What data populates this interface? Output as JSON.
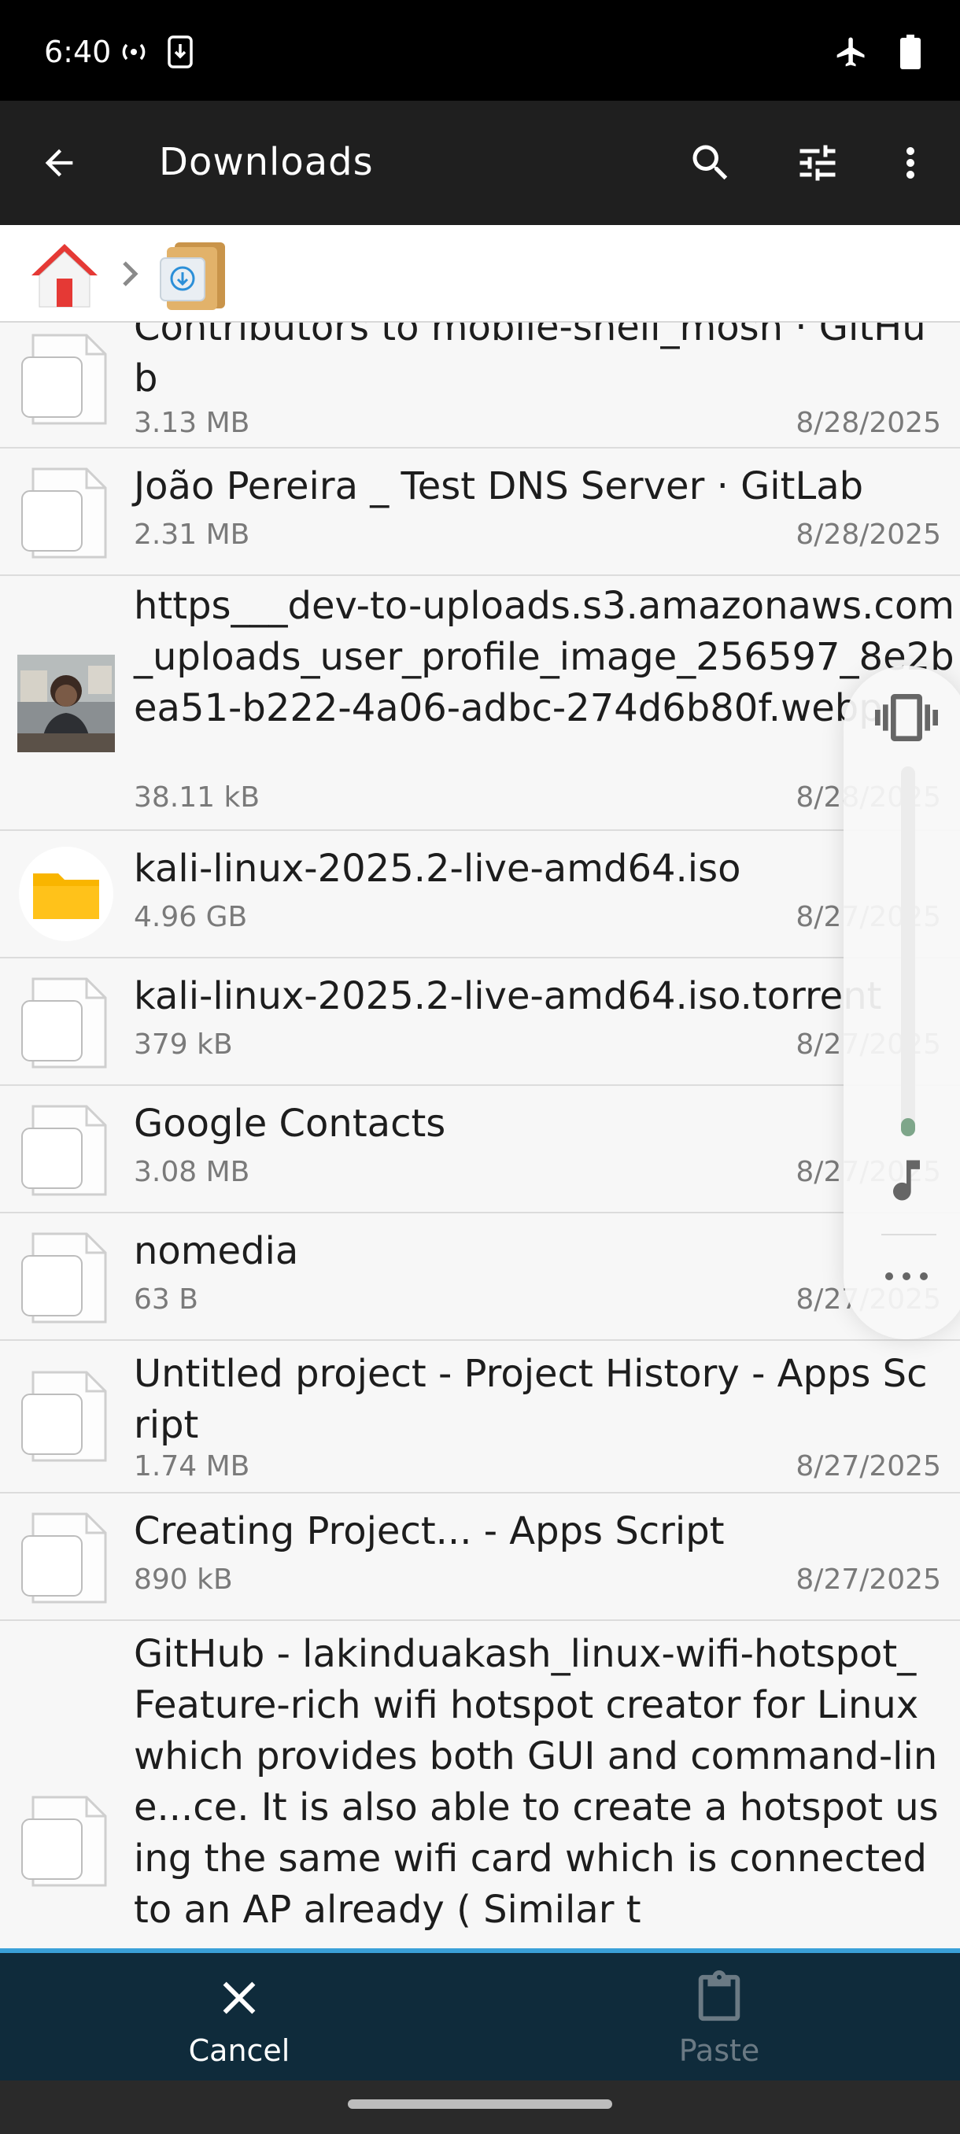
{
  "status_bar": {
    "time": "6:40",
    "icons": [
      "hotspot-icon",
      "download-status-icon",
      "airplane-icon",
      "battery-icon"
    ]
  },
  "app_bar": {
    "title": "Downloads",
    "actions": [
      "back-arrow-icon",
      "search-icon",
      "tune-icon",
      "more-vert-icon"
    ]
  },
  "breadcrumb": {
    "items": [
      "home-icon",
      "downloads-folder-icon"
    ]
  },
  "files": [
    {
      "name": "Contributors to mobile-shell_mosh · GitHub",
      "size": "3.13 MB",
      "date": "8/28/2025",
      "icon": "file-icon"
    },
    {
      "name": "João Pereira _ Test DNS Server · GitLab",
      "size": "2.31 MB",
      "date": "8/28/2025",
      "icon": "file-icon"
    },
    {
      "name": "https___dev-to-uploads.s3.amazonaws.com_uploads_user_profile_image_256597_8e2bea51-b222-4a06-adbc-274d6b80f.webp",
      "size": "38.11 kB",
      "date": "8/28/2025",
      "icon": "image-thumbnail"
    },
    {
      "name": "kali-linux-2025.2-live-amd64.iso",
      "size": "4.96 GB",
      "date": "8/27/2025",
      "icon": "folder-icon"
    },
    {
      "name": "kali-linux-2025.2-live-amd64.iso.torrent",
      "size": "379 kB",
      "date": "8/27/2025",
      "icon": "file-icon"
    },
    {
      "name": "Google Contacts",
      "size": "3.08 MB",
      "date": "8/27/2025",
      "icon": "file-icon"
    },
    {
      "name": "nomedia",
      "size": "63 B",
      "date": "8/27/2025",
      "icon": "file-icon"
    },
    {
      "name": "Untitled project - Project History - Apps Script",
      "size": "1.74 MB",
      "date": "8/27/2025",
      "icon": "file-icon"
    },
    {
      "name": "Creating Project... - Apps Script",
      "size": "890 kB",
      "date": "8/27/2025",
      "icon": "file-icon"
    },
    {
      "name": "GitHub - lakinduakash_linux-wifi-hotspot_ Feature-rich wifi hotspot creator for Linux which provides both GUI and command-line...ce. It is also able to create a hotspot using the same wifi card which is connected to an AP already ( Similar t",
      "size": "",
      "date": "",
      "icon": "file-icon"
    }
  ],
  "volume_panel": {
    "level": 0.05,
    "icons": [
      "vibrate-icon",
      "music-note-icon",
      "more-horiz-icon"
    ]
  },
  "action_bar": {
    "cancel_label": "Cancel",
    "paste_label": "Paste"
  },
  "colors": {
    "app_bar": "#1f1f1f",
    "action_bar": "#0f2b3b",
    "accent": "#3aa0d8"
  }
}
